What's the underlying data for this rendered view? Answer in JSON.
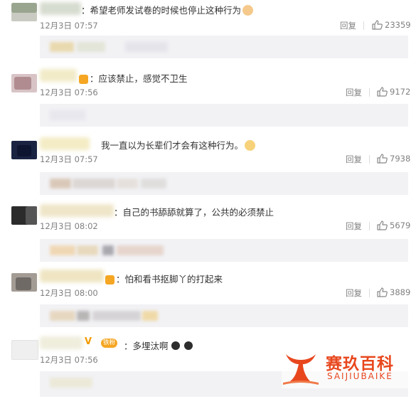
{
  "comments": [
    {
      "content": "：希望老师发试卷的时候也停止这种行为",
      "time": "12月3日 07:57",
      "reply": "回复",
      "likes": "23359"
    },
    {
      "content": "：应该禁止，感觉不卫生",
      "time": "12月3日 07:56",
      "reply": "回复",
      "likes": "9172"
    },
    {
      "content": "我一直以为长辈们才会有这种行为。",
      "time": "12月3日 07:57",
      "reply": "回复",
      "likes": "7938"
    },
    {
      "content": "：自己的书舔舔就算了，公共的必须禁止",
      "time": "12月3日 08:02",
      "reply": "回复",
      "likes": "5679"
    },
    {
      "content": "：怕和看书抠脚丫的打起来",
      "time": "12月3日 08:00",
      "reply": "回复",
      "likes": "3889"
    },
    {
      "content": "：多埋汰啊",
      "time": "12月3日 07:56",
      "fan_badge": "铁粉",
      "verified": "V"
    }
  ],
  "watermark": {
    "title": "赛玖百科",
    "subtitle": "SAIJIUBAIKE"
  },
  "colors": {
    "accent": "#e8471e",
    "muted": "#808080",
    "subbox": "#f2f2f5"
  }
}
